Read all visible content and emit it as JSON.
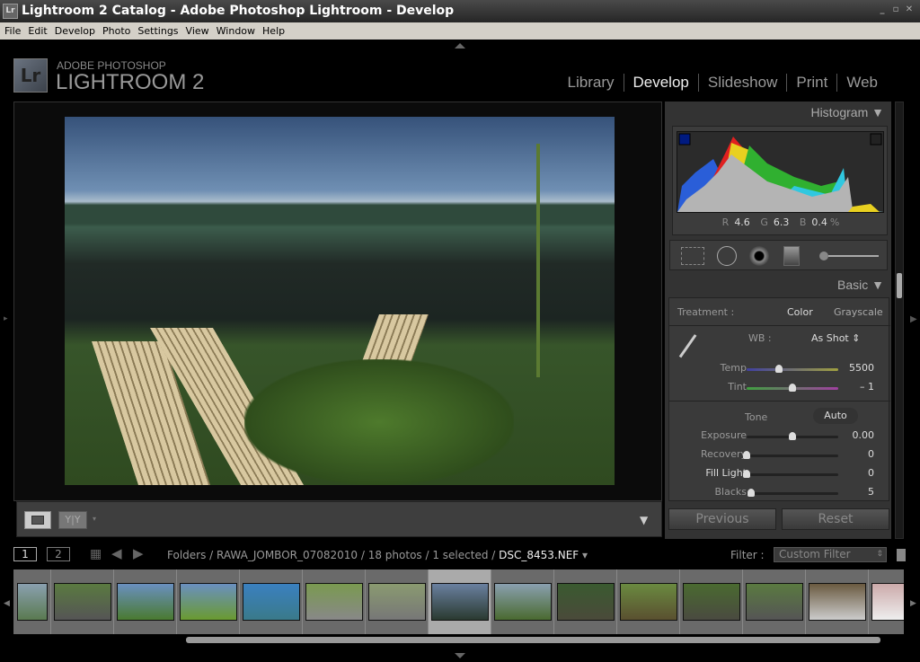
{
  "window": {
    "title": "Lightroom 2 Catalog - Adobe Photoshop Lightroom - Develop",
    "icon": "Lr"
  },
  "menu": [
    "File",
    "Edit",
    "Develop",
    "Photo",
    "Settings",
    "View",
    "Window",
    "Help"
  ],
  "brand": {
    "logo": "Lr",
    "line1": "ADOBE PHOTOSHOP",
    "line2": "LIGHTROOM 2"
  },
  "modules": [
    {
      "label": "Library"
    },
    {
      "label": "Develop",
      "active": true
    },
    {
      "label": "Slideshow"
    },
    {
      "label": "Print"
    },
    {
      "label": "Web"
    }
  ],
  "histogram": {
    "title": "Histogram",
    "r_label": "R",
    "r": "4.6",
    "g_label": "G",
    "g": "6.3",
    "b_label": "B",
    "b": "0.4",
    "pct": "%"
  },
  "basic": {
    "title": "Basic",
    "treatment_label": "Treatment :",
    "color": "Color",
    "grayscale": "Grayscale",
    "wb_label": "WB :",
    "wb_value": "As Shot",
    "tone_label": "Tone",
    "auto": "Auto",
    "sliders": [
      {
        "label": "Temp",
        "value": "5500",
        "pos": 0.35
      },
      {
        "label": "Tint",
        "value": "– 1",
        "pos": 0.5
      },
      {
        "label": "Exposure",
        "value": "0.00",
        "pos": 0.5
      },
      {
        "label": "Recovery",
        "value": "0",
        "pos": 0.0
      },
      {
        "label": "Fill Light",
        "value": "0",
        "pos": 0.0
      },
      {
        "label": "Blacks",
        "value": "5",
        "pos": 0.05
      }
    ]
  },
  "buttons": {
    "previous": "Previous",
    "reset": "Reset"
  },
  "filmstrip": {
    "view1": "1",
    "view2": "2",
    "path": "Folders / RAWA_JOMBOR_07082010 / 18 photos / 1 selected / ",
    "file": "DSC_8453.NEF",
    "filter_label": "Filter :",
    "filter_value": "Custom Filter",
    "selected_index": 6
  },
  "colors": {
    "accent": "#eeeeee",
    "panel": "#333333",
    "histogram_red": "#e02020",
    "histogram_yellow": "#e8d020",
    "histogram_blue": "#2a5ed8"
  }
}
